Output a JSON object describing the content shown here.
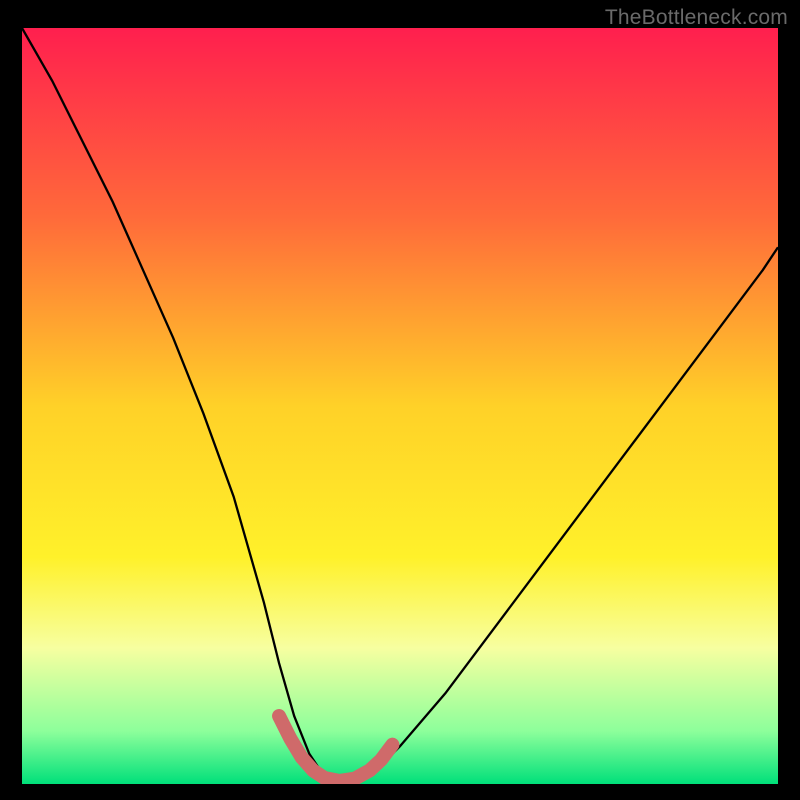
{
  "watermark": "TheBottleneck.com",
  "chart_data": {
    "type": "line",
    "title": "",
    "xlabel": "",
    "ylabel": "",
    "xlim": [
      0,
      100
    ],
    "ylim": [
      0,
      100
    ],
    "grid": false,
    "legend": false,
    "background": {
      "style": "vertical-gradient",
      "stops": [
        {
          "pos": 0.0,
          "color": "#ff1f4e"
        },
        {
          "pos": 0.25,
          "color": "#ff6a3a"
        },
        {
          "pos": 0.5,
          "color": "#ffd128"
        },
        {
          "pos": 0.7,
          "color": "#fff12a"
        },
        {
          "pos": 0.82,
          "color": "#f7ffa0"
        },
        {
          "pos": 0.93,
          "color": "#8dff9b"
        },
        {
          "pos": 1.0,
          "color": "#00e07a"
        }
      ]
    },
    "series": [
      {
        "name": "bottleneck-curve",
        "color": "#000000",
        "x": [
          0,
          4,
          8,
          12,
          16,
          20,
          24,
          28,
          32,
          34,
          36,
          38,
          40,
          42,
          44,
          46,
          50,
          56,
          62,
          68,
          74,
          80,
          86,
          92,
          98,
          100
        ],
        "values": [
          100,
          93,
          85,
          77,
          68,
          59,
          49,
          38,
          24,
          16,
          9,
          4,
          1,
          0,
          0,
          1,
          5,
          12,
          20,
          28,
          36,
          44,
          52,
          60,
          68,
          71
        ]
      },
      {
        "name": "valley-marker",
        "style": "thick-polyline",
        "color": "#cf6a6a",
        "width": 14,
        "x": [
          34.0,
          35.5,
          37.0,
          38.5,
          40.0,
          42.0,
          44.0,
          46.0,
          47.5,
          49.0
        ],
        "values": [
          9.0,
          6.0,
          3.5,
          1.8,
          0.8,
          0.4,
          0.7,
          1.8,
          3.2,
          5.2
        ]
      }
    ]
  }
}
